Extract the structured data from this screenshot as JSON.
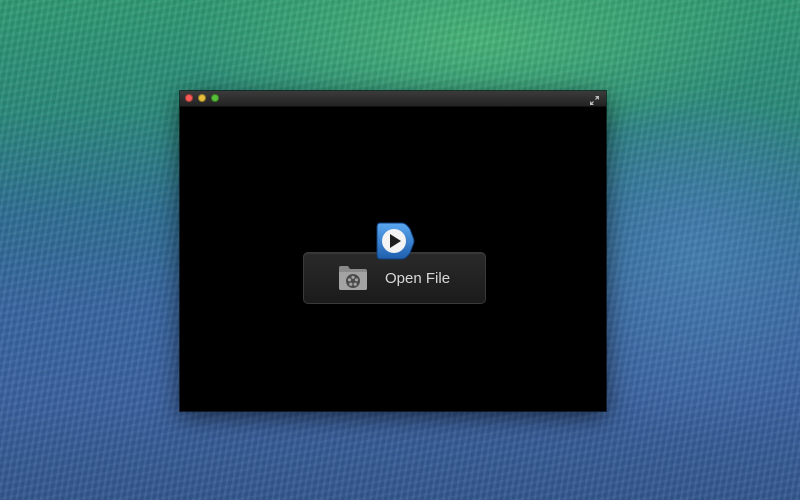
{
  "app": {
    "content": {
      "open_file_button": {
        "label": "Open File",
        "icon": "folder-film-icon"
      },
      "logo_icon": "play-icon"
    },
    "titlebar": {
      "buttons": [
        "close",
        "minimize",
        "zoom"
      ],
      "fullscreen_icon": "fullscreen-arrows-icon"
    }
  },
  "colors": {
    "window_background": "#000000",
    "play_accent": "#3a86d6",
    "close": "#fc5b57",
    "minimize": "#e5bf3c",
    "zoom": "#57c038",
    "button_text": "#d8d8d8"
  }
}
